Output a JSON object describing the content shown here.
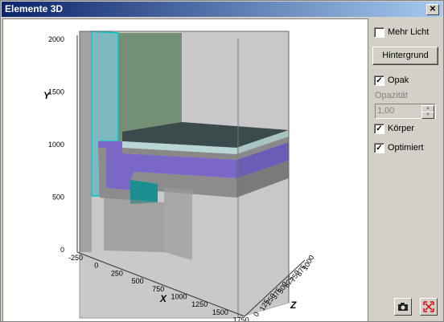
{
  "window": {
    "title": "Elemente 3D",
    "close_glyph": "✕"
  },
  "panel": {
    "mehr_licht": {
      "label": "Mehr Licht",
      "checked": false
    },
    "hintergrund_label": "Hintergrund",
    "opak": {
      "label": "Opak",
      "checked": true
    },
    "opazitaet_label": "Opazität",
    "opazitaet_value": "1,00",
    "koerper": {
      "label": "Körper",
      "checked": true
    },
    "optimiert": {
      "label": "Optimiert",
      "checked": true
    },
    "camera_icon": "camera-icon",
    "fit_icon": "fit-view-icon"
  },
  "axes": {
    "y_title": "Y",
    "x_title": "X",
    "z_title": "Z",
    "y_ticks": [
      "0",
      "500",
      "1000",
      "1500",
      "2000"
    ],
    "x_ticks": [
      "-250",
      "0",
      "250",
      "500",
      "750",
      "1000",
      "1250",
      "1500",
      "1750"
    ],
    "z_ticks": [
      "0",
      "125",
      "250",
      "375",
      "500",
      "625",
      "750",
      "875",
      "1000"
    ]
  },
  "colors": {
    "wall": "#6ec9c9",
    "slab_purple": "#7b68c6",
    "slab_top": "#3b4a4a",
    "green_panel": "#6a8a6a"
  }
}
